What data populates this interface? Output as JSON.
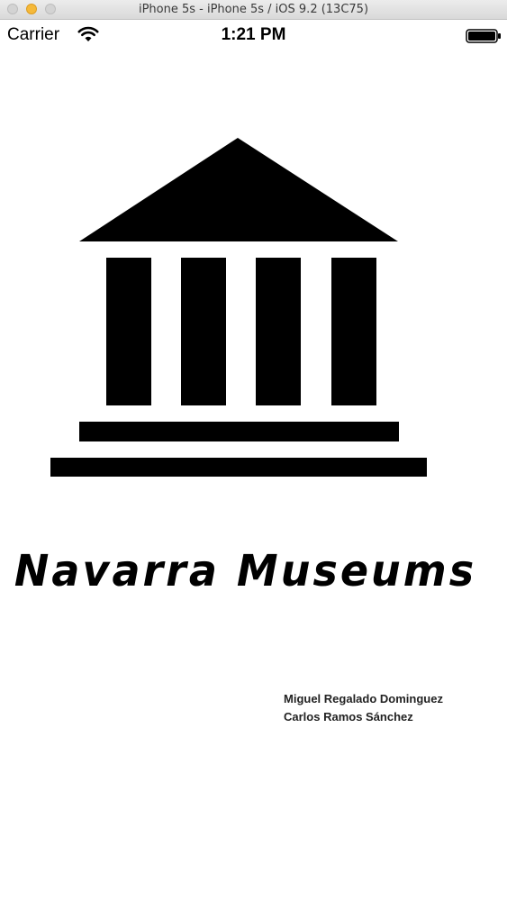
{
  "window": {
    "title": "iPhone 5s - iPhone 5s / iOS 9.2 (13C75)"
  },
  "status_bar": {
    "carrier": "Carrier",
    "time": "1:21 PM",
    "wifi_icon": "wifi-icon",
    "battery_icon": "battery-icon"
  },
  "splash": {
    "logo_icon": "museum-building-icon",
    "title": "Navarra Museums",
    "credits": [
      "Miguel Regalado Dominguez",
      "Carlos Ramos Sánchez"
    ]
  },
  "colors": {
    "background": "#ffffff",
    "foreground": "#000000",
    "minimize_button": "#f5b93a"
  }
}
